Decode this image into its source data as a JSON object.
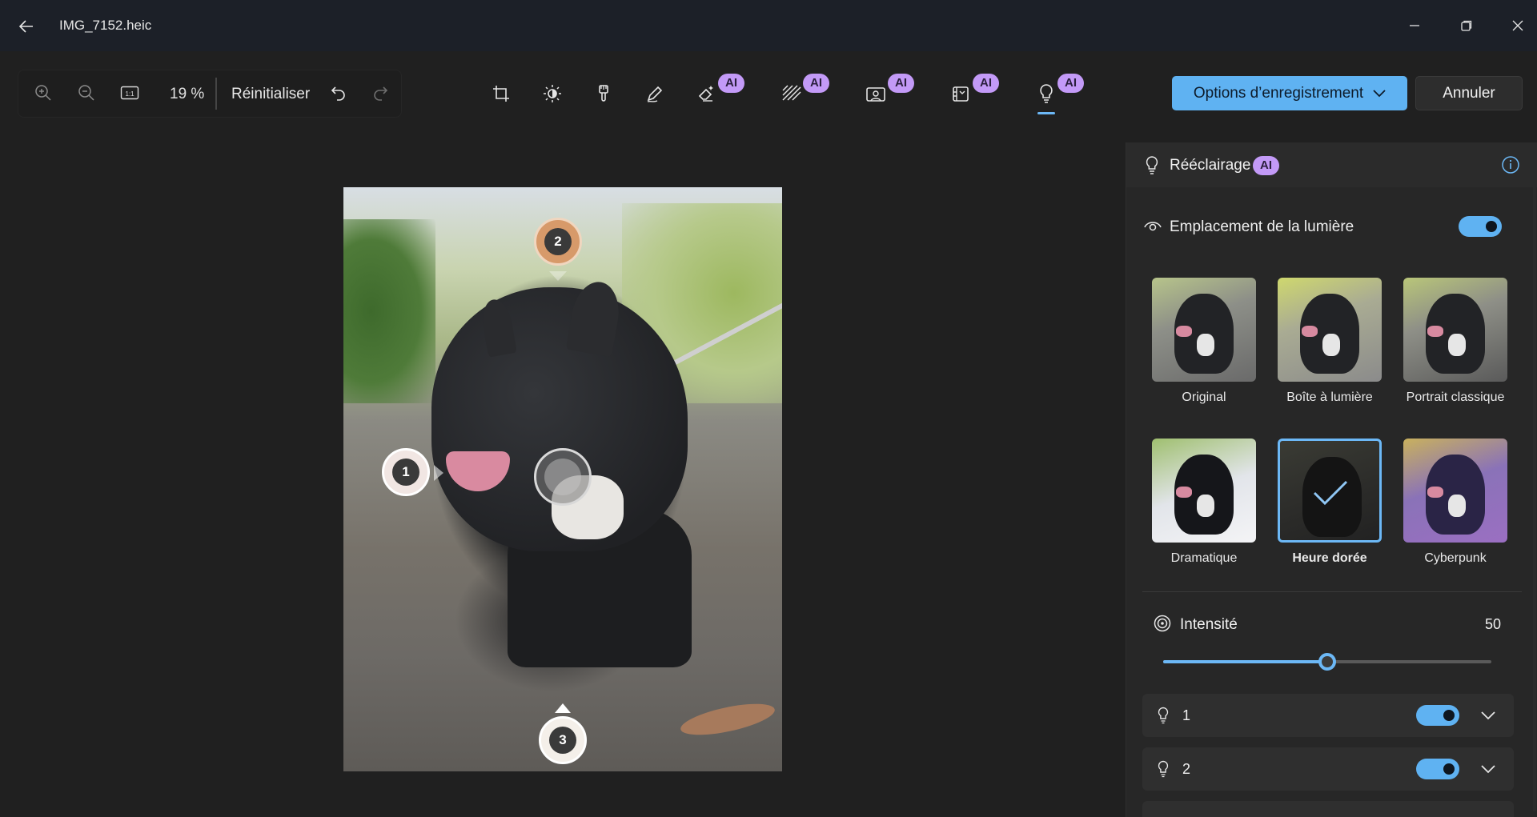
{
  "window": {
    "title": "IMG_7152.heic"
  },
  "toolbar": {
    "zoom_level": "19 %",
    "reset_label": "Réinitialiser",
    "tools": [
      {
        "name": "crop",
        "ai": false
      },
      {
        "name": "adjust",
        "ai": false
      },
      {
        "name": "filter",
        "ai": false
      },
      {
        "name": "markup",
        "ai": false
      },
      {
        "name": "erase",
        "ai": true,
        "badge": "AI"
      },
      {
        "name": "background-blur",
        "ai": true,
        "badge": "AI"
      },
      {
        "name": "background",
        "ai": true,
        "badge": "AI"
      },
      {
        "name": "style",
        "ai": true,
        "badge": "AI"
      },
      {
        "name": "relight",
        "ai": true,
        "badge": "AI",
        "active": true
      }
    ],
    "save_label": "Options d’enregistrement",
    "cancel_label": "Annuler"
  },
  "canvas": {
    "markers": [
      "1",
      "2",
      "3"
    ]
  },
  "panel": {
    "title": "Rééclairage",
    "title_badge": "AI",
    "light_placement_label": "Emplacement de la lumière",
    "light_placement_on": true,
    "presets": [
      {
        "label": "Original",
        "selected": false
      },
      {
        "label": "Boîte à lumière",
        "selected": false
      },
      {
        "label": "Portrait classique",
        "selected": false
      },
      {
        "label": "Dramatique",
        "selected": false
      },
      {
        "label": "Heure dorée",
        "selected": true
      },
      {
        "label": "Cyberpunk",
        "selected": false
      }
    ],
    "intensity_label": "Intensité",
    "intensity_value": "50",
    "intensity_fraction": 0.5,
    "lights": [
      {
        "label": "1",
        "on": true
      },
      {
        "label": "2",
        "on": true
      }
    ]
  },
  "colors": {
    "accent": "#5fb2f2",
    "ai_badge": "#c39af7",
    "background": "#202020",
    "panel": "#272727"
  }
}
